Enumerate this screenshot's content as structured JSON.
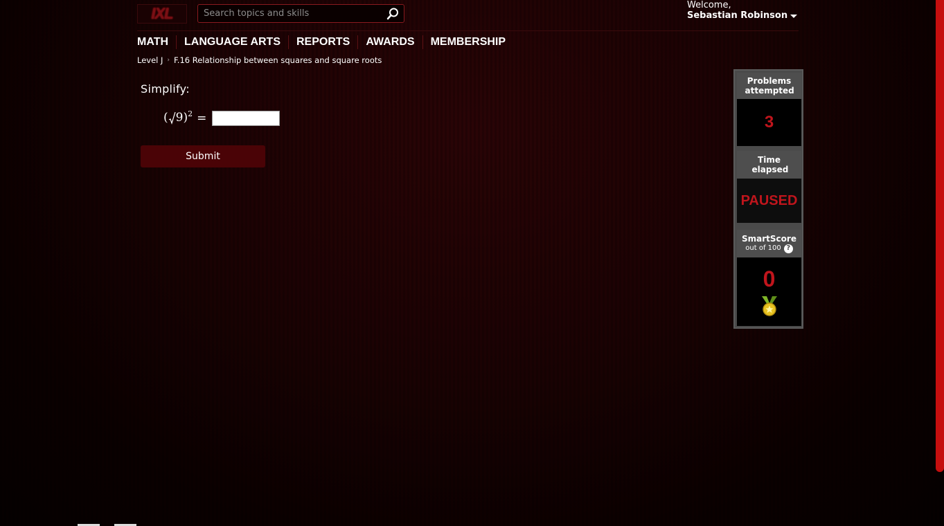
{
  "logo": {
    "text": "IXL"
  },
  "search": {
    "placeholder": "Search topics and skills"
  },
  "user": {
    "welcome": "Welcome,",
    "name": "Sebastian Robinson"
  },
  "nav": [
    "MATH",
    "LANGUAGE ARTS",
    "REPORTS",
    "AWARDS",
    "MEMBERSHIP"
  ],
  "breadcrumb": {
    "level": "Level J",
    "skill": "F.16 Relationship between squares and square roots"
  },
  "question": {
    "prompt": "Simplify:",
    "radicand": "9",
    "exponent": "2",
    "equals": "=",
    "answer_value": ""
  },
  "submit_label": "Submit",
  "stats": {
    "problems_label": "Problems attempted",
    "problems_value": "3",
    "time_label": "Time elapsed",
    "time_value": "PAUSED",
    "smartscore_label": "SmartScore",
    "smartscore_sub": "out of 100",
    "smartscore_value": "0",
    "help": "?"
  },
  "colors": {
    "accent": "#c0151c",
    "button": "#4a0306",
    "panel": "#4e4e4e"
  }
}
